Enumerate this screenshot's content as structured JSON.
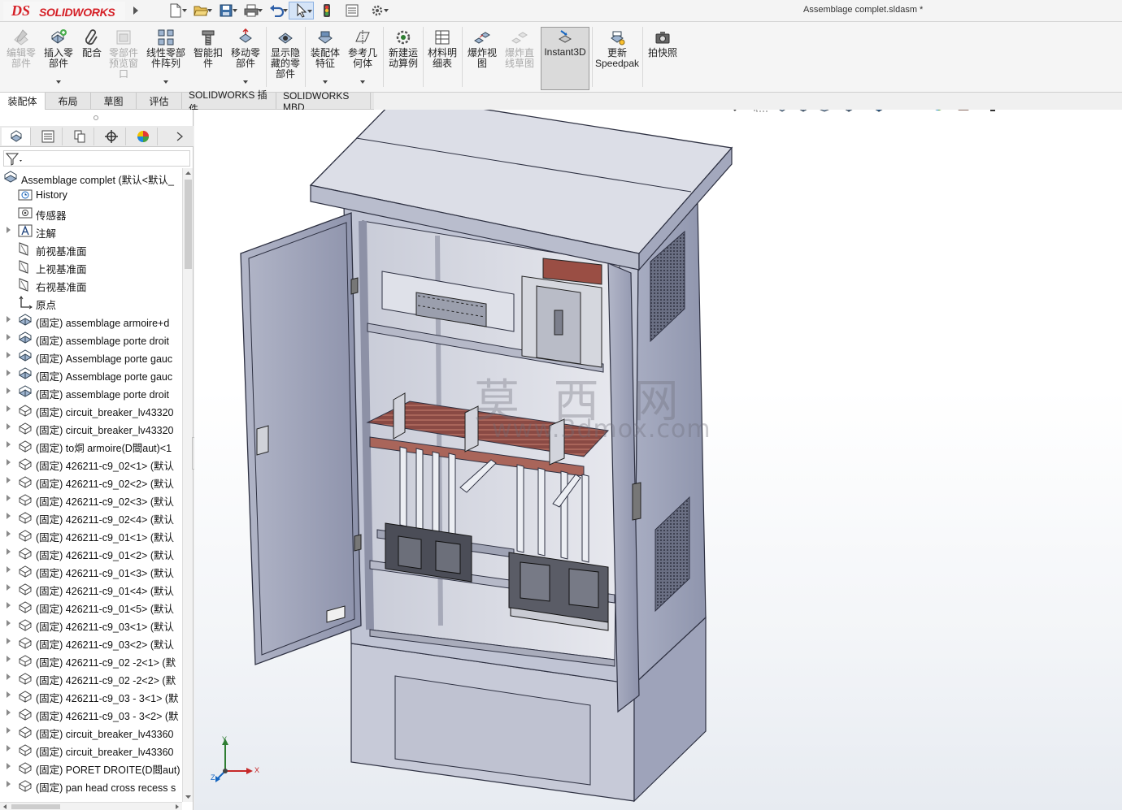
{
  "app": {
    "brand_prefix": "DS",
    "brand_name": "SOLIDWORKS",
    "document_title": "Assemblage complet.sldasm *"
  },
  "quick_access": [
    {
      "name": "new-document",
      "icon": "new-document-icon"
    },
    {
      "name": "open",
      "icon": "open-folder-icon"
    },
    {
      "name": "save",
      "icon": "save-icon"
    },
    {
      "name": "print",
      "icon": "print-icon"
    },
    {
      "name": "undo",
      "icon": "undo-icon"
    },
    {
      "name": "select",
      "icon": "select-arrow-icon",
      "selected": true
    },
    {
      "name": "rebuild",
      "icon": "traffic-light-icon"
    },
    {
      "name": "file-properties",
      "icon": "file-properties-icon"
    },
    {
      "name": "options",
      "icon": "gear-icon"
    }
  ],
  "ribbon": {
    "commands": [
      {
        "label": "编辑零\n部件",
        "enabled": false
      },
      {
        "label": "插入零\n部件",
        "enabled": true
      },
      {
        "label": "配合",
        "enabled": true
      },
      {
        "label": "零部件\n预览窗\n口",
        "enabled": false
      },
      {
        "label": "线性零部\n件阵列",
        "enabled": true
      },
      {
        "label": "智能扣\n件",
        "enabled": true
      },
      {
        "label": "移动零\n部件",
        "enabled": true
      },
      {
        "label": "显示隐\n藏的零\n部件",
        "enabled": true
      },
      {
        "label": "装配体\n特征",
        "enabled": true
      },
      {
        "label": "参考几\n何体",
        "enabled": true
      },
      {
        "label": "新建运\n动算例",
        "enabled": true
      },
      {
        "label": "材料明\n细表",
        "enabled": true
      },
      {
        "label": "爆炸视\n图",
        "enabled": true
      },
      {
        "label": "爆炸直\n线草图",
        "enabled": false
      },
      {
        "label": "Instant3D",
        "enabled": true,
        "active": true
      },
      {
        "label": "更新\nSpeedpak",
        "enabled": true
      },
      {
        "label": "拍快照",
        "enabled": true
      }
    ]
  },
  "tabs": [
    {
      "label": "装配体",
      "active": true
    },
    {
      "label": "布局"
    },
    {
      "label": "草图"
    },
    {
      "label": "评估"
    },
    {
      "label": "SOLIDWORKS 插件"
    },
    {
      "label": "SOLIDWORKS MBD"
    }
  ],
  "panel_tabs": [
    {
      "icon": "featuremanager-icon",
      "active": true
    },
    {
      "icon": "propertymanager-icon"
    },
    {
      "icon": "configurationmanager-icon"
    },
    {
      "icon": "dimxpert-icon"
    },
    {
      "icon": "appearance-icon"
    }
  ],
  "tree": [
    {
      "text": "Assemblage complet  (默认<默认_",
      "icon": "assembly",
      "indent": 0,
      "expandable": false
    },
    {
      "text": "History",
      "icon": "history",
      "indent": 1,
      "expandable": false
    },
    {
      "text": "传感器",
      "icon": "sensor",
      "indent": 1,
      "expandable": false
    },
    {
      "text": "注解",
      "icon": "annotation",
      "indent": 1,
      "expandable": true
    },
    {
      "text": "前视基准面",
      "icon": "plane",
      "indent": 1,
      "expandable": false
    },
    {
      "text": "上视基准面",
      "icon": "plane",
      "indent": 1,
      "expandable": false
    },
    {
      "text": "右视基准面",
      "icon": "plane",
      "indent": 1,
      "expandable": false
    },
    {
      "text": "原点",
      "icon": "origin",
      "indent": 1,
      "expandable": false
    },
    {
      "text": "(固定) assemblage armoire+d",
      "icon": "subassembly",
      "indent": 1,
      "expandable": true
    },
    {
      "text": "(固定) assemblage porte droit",
      "icon": "subassembly",
      "indent": 1,
      "expandable": true
    },
    {
      "text": "(固定) Assemblage porte gauc",
      "icon": "subassembly",
      "indent": 1,
      "expandable": true
    },
    {
      "text": "(固定) Assemblage porte gauc",
      "icon": "subassembly",
      "indent": 1,
      "expandable": true
    },
    {
      "text": "(固定) assemblage porte droit",
      "icon": "subassembly",
      "indent": 1,
      "expandable": true
    },
    {
      "text": "(固定) circuit_breaker_lv43320",
      "icon": "part",
      "indent": 1,
      "expandable": true
    },
    {
      "text": "(固定) circuit_breaker_lv43320",
      "icon": "part",
      "indent": 1,
      "expandable": true
    },
    {
      "text": "(固定) to烔 armoire(D閸aut)<1",
      "icon": "part",
      "indent": 1,
      "expandable": true
    },
    {
      "text": "(固定) 426211-c9_02<1> (默认",
      "icon": "part",
      "indent": 1,
      "expandable": true
    },
    {
      "text": "(固定) 426211-c9_02<2> (默认",
      "icon": "part",
      "indent": 1,
      "expandable": true
    },
    {
      "text": "(固定) 426211-c9_02<3> (默认",
      "icon": "part",
      "indent": 1,
      "expandable": true
    },
    {
      "text": "(固定) 426211-c9_02<4> (默认",
      "icon": "part",
      "indent": 1,
      "expandable": true
    },
    {
      "text": "(固定) 426211-c9_01<1> (默认",
      "icon": "part",
      "indent": 1,
      "expandable": true
    },
    {
      "text": "(固定) 426211-c9_01<2> (默认",
      "icon": "part",
      "indent": 1,
      "expandable": true
    },
    {
      "text": "(固定) 426211-c9_01<3> (默认",
      "icon": "part",
      "indent": 1,
      "expandable": true
    },
    {
      "text": "(固定) 426211-c9_01<4> (默认",
      "icon": "part",
      "indent": 1,
      "expandable": true
    },
    {
      "text": "(固定) 426211-c9_01<5> (默认",
      "icon": "part",
      "indent": 1,
      "expandable": true
    },
    {
      "text": "(固定) 426211-c9_03<1> (默认",
      "icon": "part",
      "indent": 1,
      "expandable": true
    },
    {
      "text": "(固定) 426211-c9_03<2> (默认",
      "icon": "part",
      "indent": 1,
      "expandable": true
    },
    {
      "text": "(固定) 426211-c9_02 -2<1> (默",
      "icon": "part",
      "indent": 1,
      "expandable": true
    },
    {
      "text": "(固定) 426211-c9_02 -2<2> (默",
      "icon": "part",
      "indent": 1,
      "expandable": true
    },
    {
      "text": "(固定) 426211-c9_03 - 3<1> (默",
      "icon": "part",
      "indent": 1,
      "expandable": true
    },
    {
      "text": "(固定) 426211-c9_03 - 3<2> (默",
      "icon": "part",
      "indent": 1,
      "expandable": true
    },
    {
      "text": "(固定) circuit_breaker_lv43360",
      "icon": "part",
      "indent": 1,
      "expandable": true
    },
    {
      "text": "(固定) circuit_breaker_lv43360",
      "icon": "part",
      "indent": 1,
      "expandable": true
    },
    {
      "text": "(固定) PORET DROITE(D閸aut)",
      "icon": "part",
      "indent": 1,
      "expandable": true
    },
    {
      "text": "(固定) pan head cross recess s",
      "icon": "part",
      "indent": 1,
      "expandable": true
    }
  ],
  "viewport": {
    "watermark_cn": "莫 西 网",
    "watermark_url": "www.3dmox.com",
    "triad": {
      "x": "X",
      "y": "Y",
      "z": "Z"
    },
    "hud_icons": [
      "zoom-to-fit-icon",
      "zoom-area-icon",
      "previous-view-icon",
      "section-view-icon",
      "dynamic-annotation-icon",
      "view-orientation-icon",
      "display-style-icon",
      "hide-show-icon",
      "edit-appearance-icon",
      "apply-scene-icon",
      "view-settings-icon"
    ]
  }
}
